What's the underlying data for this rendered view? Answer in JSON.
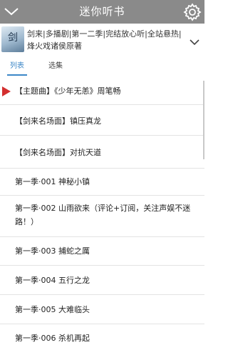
{
  "header": {
    "title": "迷你听书",
    "left_icon": "chevron-down-icon",
    "right_icon": "gear-icon"
  },
  "album": {
    "cover_glyph": "剑",
    "description": "剑来|多播剧|第一二季|完结放心听|全站悬热|烽火戏诸侯原著"
  },
  "tabs": [
    {
      "label": "列表",
      "active": true
    },
    {
      "label": "选集",
      "active": false
    }
  ],
  "tracks": [
    {
      "title": "【主题曲】《少年无恙》周笔畅",
      "playing": true
    },
    {
      "title": "【剑来名场面】镇压真龙",
      "playing": false
    },
    {
      "title": "【剑来名场面】对抗天道",
      "playing": false
    },
    {
      "title": "第一季·001 神秘小镇",
      "playing": false
    },
    {
      "title": "第一季·002 山雨欲来（评论+订阅，关注声娱不迷路！）",
      "playing": false
    },
    {
      "title": "第一季·003 捕蛇之厲",
      "playing": false
    },
    {
      "title": "第一季·004 五行之龙",
      "playing": false
    },
    {
      "title": "第一季·005 大难临头",
      "playing": false
    },
    {
      "title": "第一季·006 杀机再起",
      "playing": false
    }
  ],
  "colors": {
    "header_bg": "#8a8a8a",
    "accent": "#3c87c7",
    "playing_marker": "#d32f2f"
  }
}
